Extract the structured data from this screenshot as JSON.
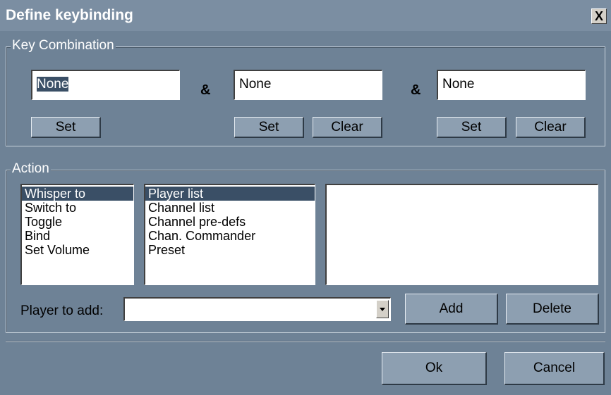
{
  "window": {
    "title": "Define keybinding",
    "close_symbol": "X"
  },
  "key_combination": {
    "label": "Key Combination",
    "ampersand": "&",
    "keys": [
      {
        "value": "None",
        "set_label": "Set"
      },
      {
        "value": "None",
        "set_label": "Set",
        "clear_label": "Clear"
      },
      {
        "value": "None",
        "set_label": "Set",
        "clear_label": "Clear"
      }
    ]
  },
  "action": {
    "label": "Action",
    "actions": [
      "Whisper to",
      "Switch to",
      "Toggle",
      "Bind",
      "Set Volume"
    ],
    "targets": [
      "Player list",
      "Channel list",
      "Channel pre-defs",
      "Chan. Commander",
      "Preset"
    ],
    "player_to_add_label": "Player to add:",
    "player_to_add_value": "",
    "add_label": "Add",
    "delete_label": "Delete"
  },
  "footer": {
    "ok_label": "Ok",
    "cancel_label": "Cancel"
  }
}
